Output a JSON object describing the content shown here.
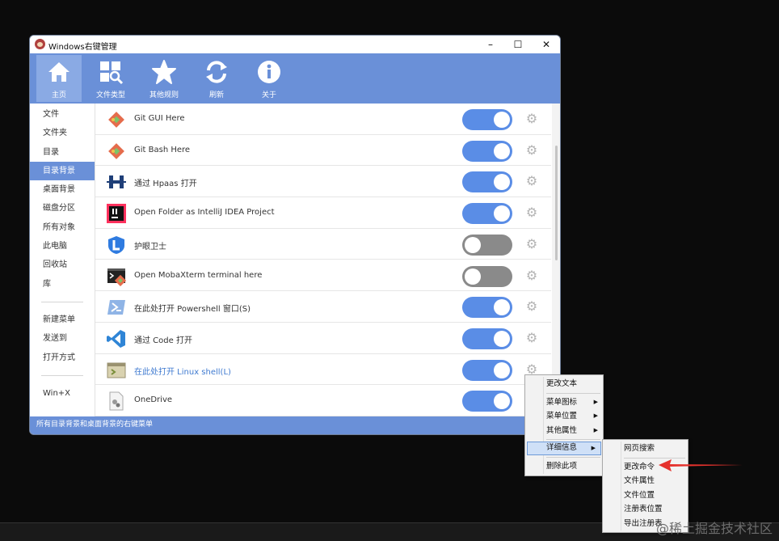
{
  "window": {
    "title": "Windows右键管理",
    "min": "–",
    "max": "☐",
    "close": "✕"
  },
  "toolbar": {
    "items": [
      {
        "label": "主页",
        "icon": "home-icon"
      },
      {
        "label": "文件类型",
        "icon": "file-type-search-icon"
      },
      {
        "label": "其他规则",
        "icon": "star-icon"
      },
      {
        "label": "刷新",
        "icon": "refresh-icon"
      },
      {
        "label": "关于",
        "icon": "info-icon"
      }
    ]
  },
  "sidebar": {
    "items": [
      "文件",
      "文件夹",
      "目录",
      "目录背景",
      "桌面背景",
      "磁盘分区",
      "所有对象",
      "此电脑",
      "回收站",
      "库"
    ],
    "items2": [
      "新建菜单",
      "发送到",
      "打开方式"
    ],
    "items3": [
      "Win+X"
    ],
    "selected": "目录背景"
  },
  "rows": [
    {
      "label": "Git GUI Here",
      "icon": "git-icon",
      "enabled": true
    },
    {
      "label": "Git Bash Here",
      "icon": "git-icon",
      "enabled": true
    },
    {
      "label": "通过 Hpaas 打开",
      "icon": "hpaas-icon",
      "enabled": true
    },
    {
      "label": "Open Folder as IntelliJ IDEA Project",
      "icon": "intellij-icon",
      "enabled": true
    },
    {
      "label": "护眼卫士",
      "icon": "eye-guard-icon",
      "enabled": false
    },
    {
      "label": "Open MobaXterm terminal here",
      "icon": "mobaxterm-icon",
      "enabled": false
    },
    {
      "label": "在此处打开 Powershell 窗口(S)",
      "icon": "powershell-icon",
      "enabled": true
    },
    {
      "label": "通过 Code 打开",
      "icon": "vscode-icon",
      "enabled": true
    },
    {
      "label": "在此处打开 Linux shell(L)",
      "icon": "linux-shell-icon",
      "enabled": true,
      "highlighted": true
    },
    {
      "label": "OneDrive",
      "icon": "onedrive-icon",
      "enabled": true
    }
  ],
  "status": {
    "text": "所有目录背景和桌面背景的右键菜单"
  },
  "context_menu": {
    "items": [
      "更改文本",
      "菜单图标",
      "菜单位置",
      "其他属性",
      "详细信息",
      "删除此项"
    ],
    "submenu_arrow": "▶"
  },
  "sub_menu": {
    "items": [
      "网页搜索",
      "更改命令",
      "文件属性",
      "文件位置",
      "注册表位置",
      "导出注册表"
    ]
  },
  "watermark": "@稀土掘金技术社区",
  "colors": {
    "accent": "#6a90d8",
    "toggle_on": "#5a8de6",
    "toggle_off": "#8a8a8a",
    "pointer": "#e5322d"
  }
}
